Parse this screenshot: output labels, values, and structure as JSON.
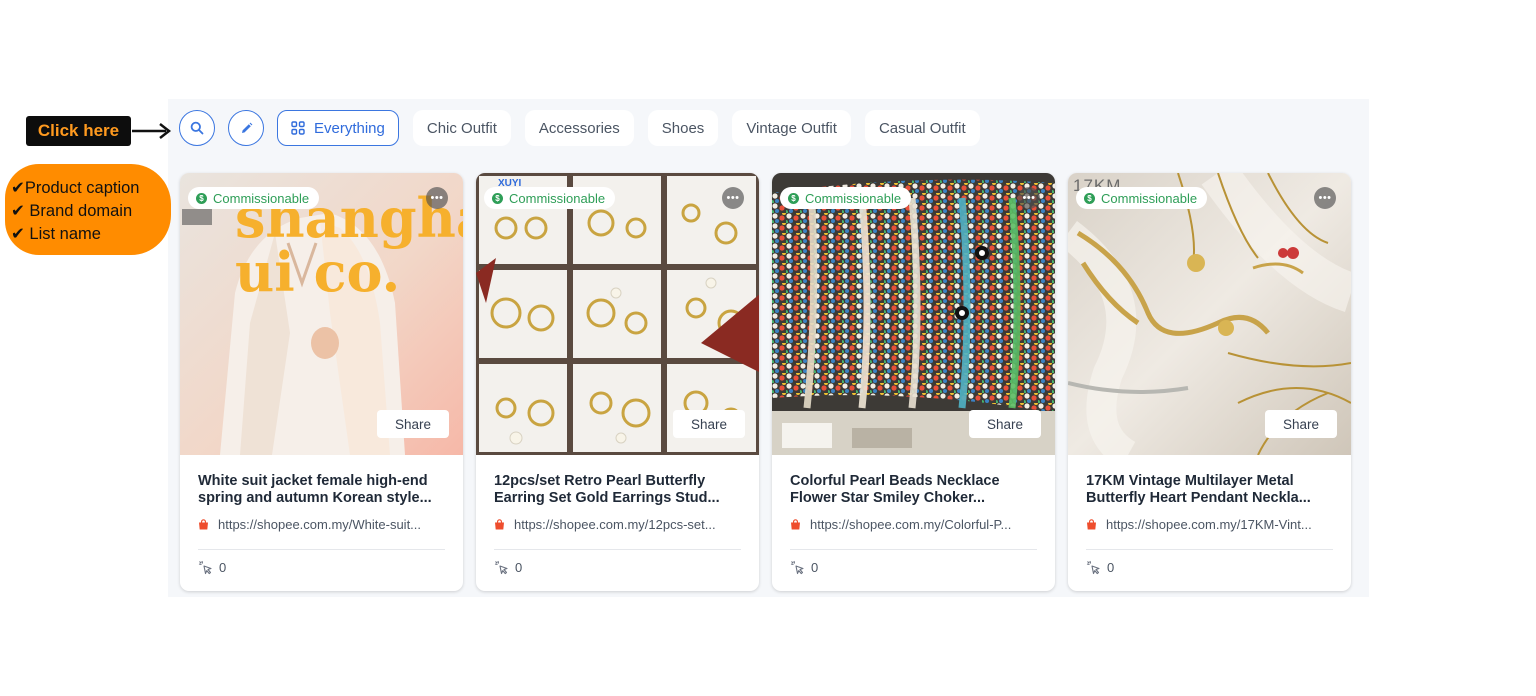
{
  "annotation": {
    "click_label": "Click here",
    "notes": [
      "✔Product caption",
      "✔ Brand domain",
      "✔ List name"
    ]
  },
  "filters": {
    "search_icon": "search-icon",
    "edit_icon": "pencil-icon",
    "tabs": [
      {
        "label": "Everything",
        "active": true,
        "icon": "grid-icon"
      },
      {
        "label": "Chic Outfit",
        "active": false
      },
      {
        "label": "Accessories",
        "active": false
      },
      {
        "label": "Shoes",
        "active": false
      },
      {
        "label": "Vintage Outfit",
        "active": false
      },
      {
        "label": "Casual Outfit",
        "active": false
      }
    ]
  },
  "cards": [
    {
      "badge": "Commissionable",
      "image_text": "shanghai ui co.",
      "share_label": "Share",
      "title_line1": "White suit jacket female high-end",
      "title_line2": "spring and autumn Korean style...",
      "url": "https://shopee.com.my/White-suit...",
      "clicks": "0"
    },
    {
      "badge": "Commissionable",
      "image_text": "XUYI",
      "share_label": "Share",
      "title_line1": "12pcs/set Retro Pearl Butterfly",
      "title_line2": "Earring Set Gold Earrings Stud...",
      "url": "https://shopee.com.my/12pcs-set...",
      "clicks": "0"
    },
    {
      "badge": "Commissionable",
      "share_label": "Share",
      "title_line1": "Colorful Pearl Beads Necklace",
      "title_line2": "Flower Star Smiley Choker...",
      "url": "https://shopee.com.my/Colorful-P...",
      "clicks": "0"
    },
    {
      "badge": "Commissionable",
      "image_text": "17KM",
      "share_label": "Share",
      "title_line1": "17KM Vintage Multilayer Metal",
      "title_line2": "Butterfly Heart Pendant Neckla...",
      "url": "https://shopee.com.my/17KM-Vint...",
      "clicks": "0"
    }
  ],
  "colors": {
    "accent": "#3b76e0",
    "commission_green": "#2e9e57",
    "annotation_orange": "#ff8c00",
    "shopee_red": "#ee4d2d"
  }
}
